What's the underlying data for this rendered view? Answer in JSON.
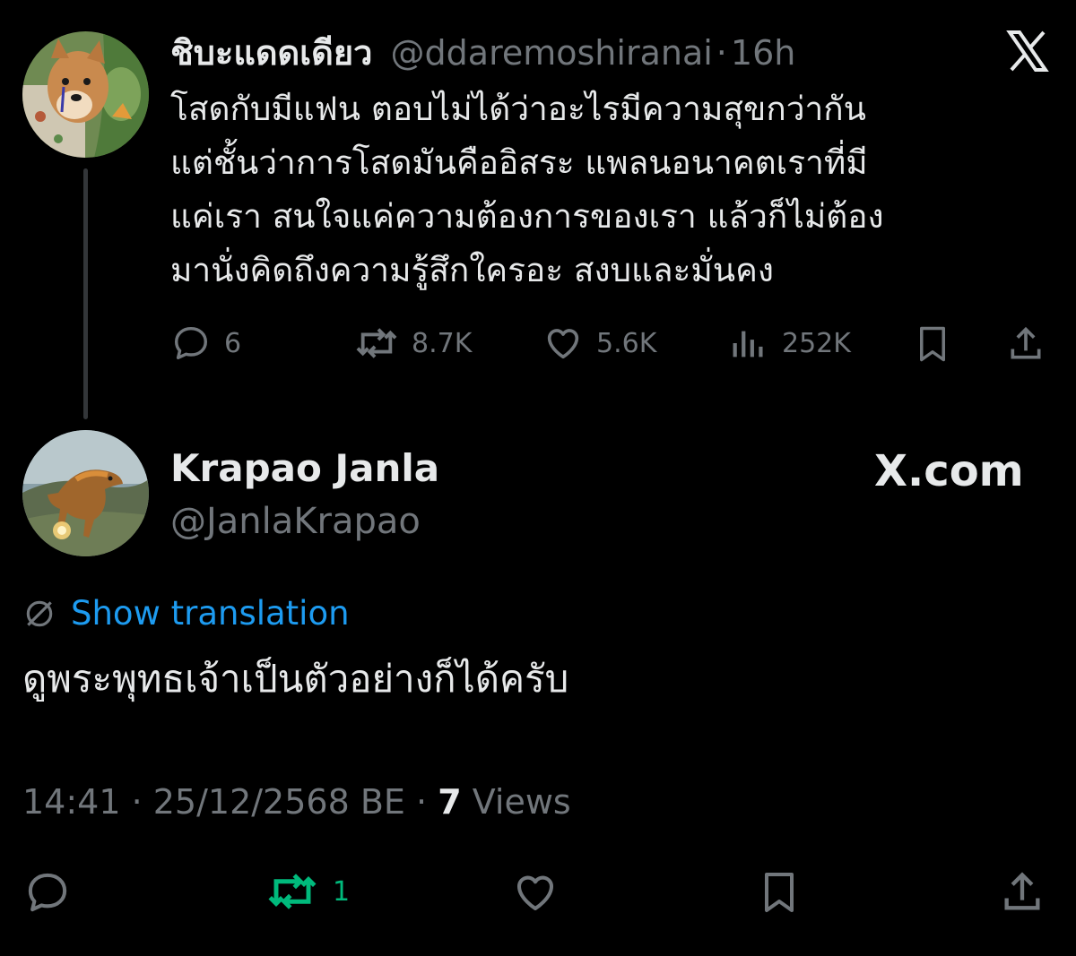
{
  "parent_tweet": {
    "display_name": "ชิบะแดดเดียว",
    "handle": "@ddaremoshiranai",
    "separator": "·",
    "time_ago": "16h",
    "text": "โสดกับมีแฟน ตอบไม่ได้ว่าอะไรมีความสุขกว่ากัน\nแต่ชั้นว่าการโสดมันคืออิสระ แพลนอนาคตเราที่มี\nแค่เรา สนใจแค่ความต้องการของเรา แล้วก็ไม่ต้อง\nมานั่งคิดถึงความรู้สึกใครอะ สงบและมั่นคง",
    "replies": "6",
    "reposts": "8.7K",
    "likes": "5.6K",
    "views": "252K",
    "avatar_icon": "shiba-dog-avatar",
    "brand_icon": "x-logo-icon"
  },
  "reply_tweet": {
    "display_name": "Krapao Janla",
    "handle": "@JanlaKrapao",
    "watermark": "X.com",
    "show_translation": "Show translation",
    "text": "ดูพระพุทธเจ้าเป็นตัวอย่างก็ได้ครับ",
    "timestamp": "14:41 · 25/12/2568 BE ·",
    "views_count": "7",
    "views_label": "Views",
    "reposts": "1",
    "avatar_icon": "dinosaur-avatar"
  },
  "colors": {
    "background": "#000000",
    "text": "#e7e9ea",
    "muted": "#71767b",
    "link": "#1d9bf0",
    "repost_active": "#00ba7c"
  }
}
